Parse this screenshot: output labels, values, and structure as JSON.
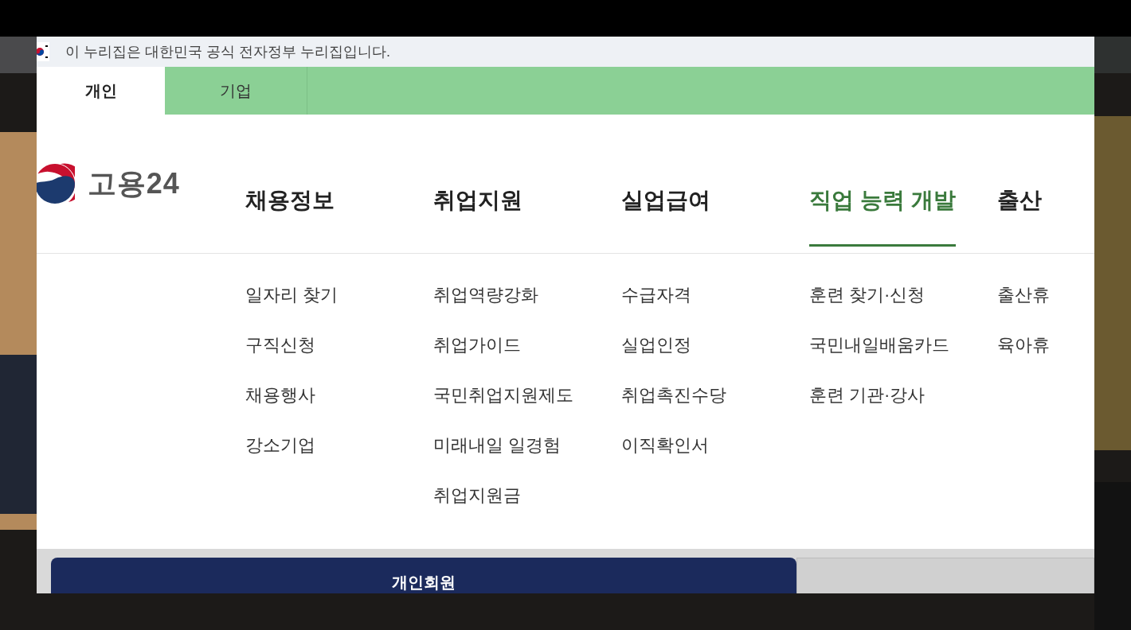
{
  "gov_banner": {
    "text": "이 누리집은 대한민국 공식 전자정부 누리집입니다."
  },
  "tabs": [
    {
      "label": "개인",
      "selected": true
    },
    {
      "label": "기업",
      "selected": false
    }
  ],
  "logo": {
    "text": "고용24"
  },
  "nav": [
    {
      "label": "채용정보",
      "selected": false,
      "submenu": [
        "일자리 찾기",
        "구직신청",
        "채용행사",
        "강소기업"
      ]
    },
    {
      "label": "취업지원",
      "selected": false,
      "submenu": [
        "취업역량강화",
        "취업가이드",
        "국민취업지원제도",
        "미래내일 일경험",
        "취업지원금"
      ]
    },
    {
      "label": "실업급여",
      "selected": false,
      "submenu": [
        "수급자격",
        "실업인정",
        "취업촉진수당",
        "이직확인서"
      ]
    },
    {
      "label": "직업 능력 개발",
      "selected": true,
      "submenu": [
        "훈련 찾기·신청",
        "국민내일배움카드",
        "훈련 기관·강사"
      ]
    },
    {
      "label": "출산",
      "selected": false,
      "submenu": [
        "출산휴",
        "육아휴"
      ]
    }
  ],
  "member_tabs": [
    {
      "label": "개인회원",
      "selected": true
    }
  ]
}
